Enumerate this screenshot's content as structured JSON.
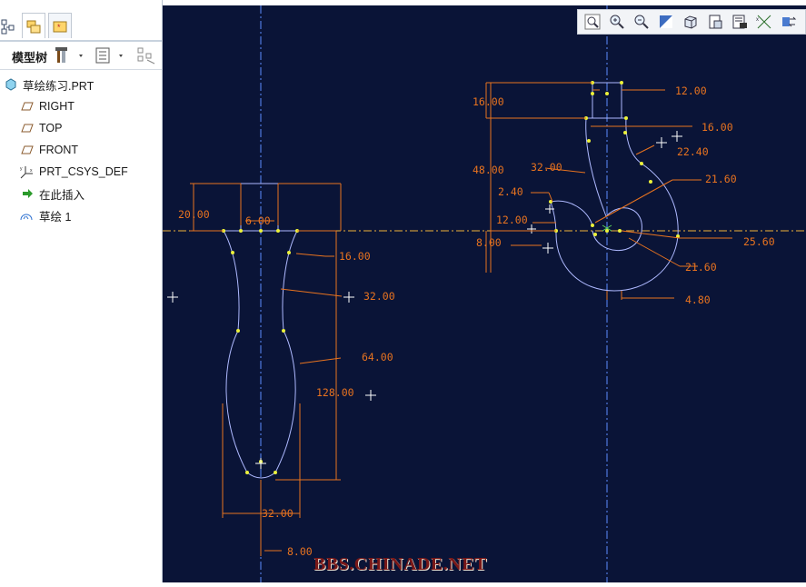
{
  "model_tree": {
    "title": "模型树",
    "items": [
      {
        "label": "草绘练习.PRT",
        "icon": "part-icon"
      },
      {
        "label": "RIGHT",
        "icon": "datum-plane-icon"
      },
      {
        "label": "TOP",
        "icon": "datum-plane-icon"
      },
      {
        "label": "FRONT",
        "icon": "datum-plane-icon"
      },
      {
        "label": "PRT_CSYS_DEF",
        "icon": "coordinate-system-icon"
      },
      {
        "label": "在此插入",
        "icon": "insert-here-arrow-icon"
      },
      {
        "label": "草绘 1",
        "icon": "sketch-icon"
      }
    ]
  },
  "canvas_toolbar": [
    "refit-icon",
    "zoom-in-icon",
    "zoom-out-icon",
    "repaint-icon",
    "orientation-icon",
    "saved-views-icon",
    "display-style-icon",
    "datum-display-icon",
    "sketcher-display-icon"
  ],
  "dimensions": {
    "left_sketch": [
      "20.00",
      "6.00",
      "16.00",
      "32.00",
      "64.00",
      "128.00",
      "32.00",
      "8.00"
    ],
    "right_sketch": [
      "12.00",
      "16.00",
      "16.00",
      "22.40",
      "48.00",
      "32.00",
      "21.60",
      "2.40",
      "12.00",
      "8.00",
      "25.60",
      "21.60",
      "4.80"
    ]
  },
  "watermark": "BBS.CHINADE.NET",
  "colors": {
    "canvas": "#0a1437",
    "geometry": "#aeb9ff",
    "dimension": "#e8731f",
    "vertex": "#ecf23a",
    "centerline": "#5c8cff"
  }
}
